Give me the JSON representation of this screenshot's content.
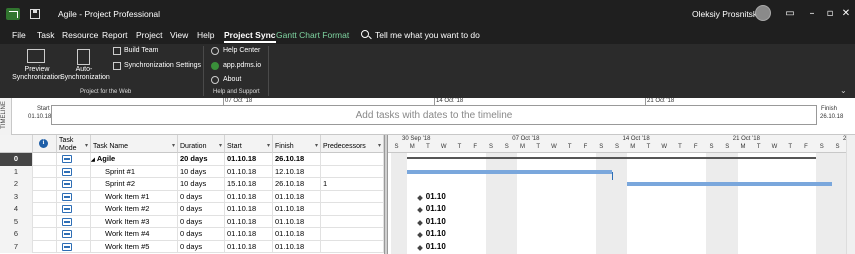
{
  "titlebar": {
    "doc_name": "Agile",
    "separator": "-",
    "app_name": "Project Professional",
    "title": "Agile  -  Project Professional",
    "user": "Oleksiy Prosnitskyy",
    "min": "–",
    "restore": "▫",
    "close": "✕"
  },
  "menu": {
    "items": [
      "File",
      "Task",
      "Resource",
      "Report",
      "Project",
      "View",
      "Help",
      "Project Sync",
      "Gantt Chart Format"
    ],
    "active": "Project Sync",
    "search_placeholder": "Tell me what you want to do"
  },
  "ribbon": {
    "preview_sync": "Preview\nSynchronization",
    "auto_sync": "Auto-\nSynchronization",
    "build_team": "Build Team",
    "sync_settings": "Synchronization Settings",
    "group1_label": "Project for the Web",
    "help_center": "Help Center",
    "app_link": "app.pdms.io",
    "about": "About",
    "group2_label": "Help and Support"
  },
  "timeline": {
    "side_label": "TIMELINE",
    "start_label": "Start",
    "start_date": "01.10.18",
    "finish_label": "Finish",
    "finish_date": "26.10.18",
    "placeholder": "Add tasks with dates to the timeline",
    "ticks": [
      "07 Oct '18",
      "14 Oct '18",
      "21 Oct '18"
    ]
  },
  "grid": {
    "headers": {
      "task_mode": "Task\nMode",
      "task_name": "Task Name",
      "duration": "Duration",
      "start": "Start",
      "finish": "Finish",
      "predecessors": "Predecessors"
    },
    "rows": [
      {
        "id": "0",
        "name": "Agile",
        "duration": "20 days",
        "start": "01.10.18",
        "finish": "26.10.18",
        "pred": "",
        "summary": true
      },
      {
        "id": "1",
        "name": "Sprint #1",
        "duration": "10 days",
        "start": "01.10.18",
        "finish": "12.10.18",
        "pred": ""
      },
      {
        "id": "2",
        "name": "Sprint #2",
        "duration": "10 days",
        "start": "15.10.18",
        "finish": "26.10.18",
        "pred": "1"
      },
      {
        "id": "3",
        "name": "Work Item #1",
        "duration": "0 days",
        "start": "01.10.18",
        "finish": "01.10.18",
        "pred": ""
      },
      {
        "id": "4",
        "name": "Work Item #2",
        "duration": "0 days",
        "start": "01.10.18",
        "finish": "01.10.18",
        "pred": ""
      },
      {
        "id": "5",
        "name": "Work Item #3",
        "duration": "0 days",
        "start": "01.10.18",
        "finish": "01.10.18",
        "pred": ""
      },
      {
        "id": "6",
        "name": "Work Item #4",
        "duration": "0 days",
        "start": "01.10.18",
        "finish": "01.10.18",
        "pred": ""
      },
      {
        "id": "7",
        "name": "Work Item #5",
        "duration": "0 days",
        "start": "01.10.18",
        "finish": "01.10.18",
        "pred": ""
      }
    ]
  },
  "gantt": {
    "weeks": [
      "30 Sep '18",
      "07 Oct '18",
      "14 Oct '18",
      "21 Oct '18",
      "28"
    ],
    "day_letters": [
      "S",
      "M",
      "T",
      "W",
      "T",
      "F",
      "S"
    ],
    "milestone_label": "01.10"
  }
}
